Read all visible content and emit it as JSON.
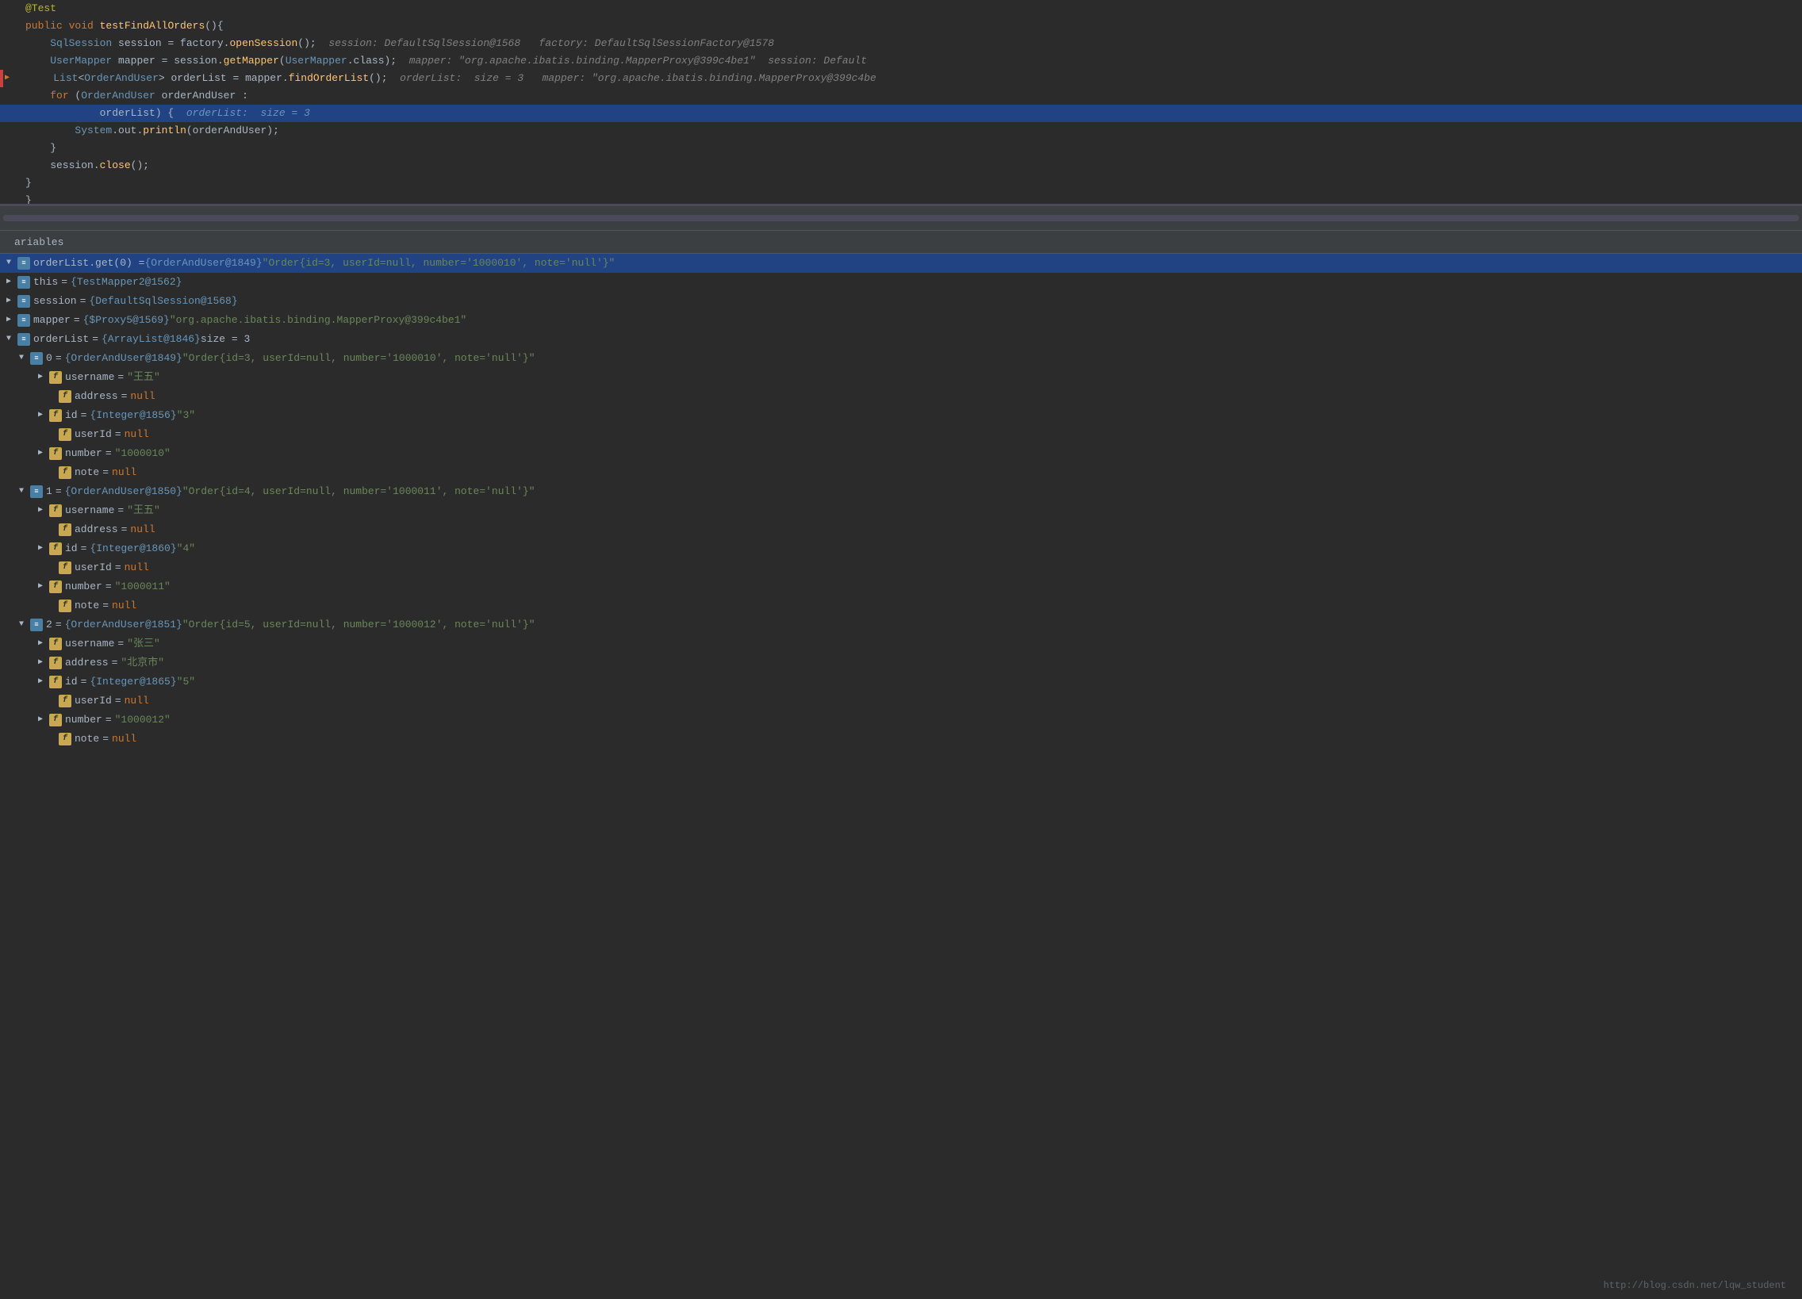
{
  "editor": {
    "lines": [
      {
        "id": 1,
        "gutter": "",
        "content": "@Test",
        "type": "annotation"
      },
      {
        "id": 2,
        "gutter": "",
        "content": "public void testFindAllOrders(){",
        "type": "normal"
      },
      {
        "id": 3,
        "gutter": "",
        "content": "    SqlSession session = factory.openSession();",
        "type": "normal",
        "debug": " session: DefaultSqlSession@1568   factory: DefaultSqlSessionFactory@1578"
      },
      {
        "id": 4,
        "gutter": "",
        "content": "    UserMapper mapper = session.getMapper(UserMapper.class);",
        "type": "normal",
        "debug": " mapper: \"org.apache.ibatis.binding.MapperProxy@399c4be1\"  session: Default"
      },
      {
        "id": 5,
        "gutter": "arrow",
        "content": "    List<OrderAndUser> orderList = mapper.findOrderList();",
        "type": "error",
        "debug": " orderList:  size = 3   mapper: \"org.apache.ibatis.binding.MapperProxy@399c4be"
      },
      {
        "id": 6,
        "gutter": "",
        "content": "    for (OrderAndUser orderAndUser :",
        "type": "normal"
      },
      {
        "id": 7,
        "gutter": "",
        "content": "            orderList) {",
        "type": "highlighted",
        "debug": " orderList:  size = 3"
      },
      {
        "id": 8,
        "gutter": "",
        "content": "        System.out.println(orderAndUser);",
        "type": "normal"
      },
      {
        "id": 9,
        "gutter": "",
        "content": "    }",
        "type": "normal"
      },
      {
        "id": 10,
        "gutter": "",
        "content": "    session.close();",
        "type": "normal"
      },
      {
        "id": 11,
        "gutter": "",
        "content": "}",
        "type": "normal"
      },
      {
        "id": 12,
        "gutter": "",
        "content": "}",
        "type": "normal"
      }
    ]
  },
  "variables_panel": {
    "title": "ariables",
    "selected_item": "orderList.get(0) = {OrderAndUser@1849} \"Order{id=3, userId=null, number='1000010', note='null'}\"",
    "items": [
      {
        "id": "orderlist-get0",
        "indent": 0,
        "arrow": "expanded",
        "icon": "stack",
        "name": "orderList.get(0) = {OrderAndUser@1849}",
        "value": "\"Order{id=3, userId=null, number='1000010', note='null'}\"",
        "selected": true
      },
      {
        "id": "this",
        "indent": 0,
        "arrow": "collapsed",
        "icon": "stack",
        "name": "this",
        "value": "= {TestMapper2@1562}"
      },
      {
        "id": "session",
        "indent": 0,
        "arrow": "collapsed",
        "icon": "stack",
        "name": "session",
        "value": "= {DefaultSqlSession@1568}"
      },
      {
        "id": "mapper",
        "indent": 0,
        "arrow": "collapsed",
        "icon": "stack",
        "name": "mapper",
        "value": "= {$Proxy5@1569} \"org.apache.ibatis.binding.MapperProxy@399c4be1\""
      },
      {
        "id": "orderlist",
        "indent": 0,
        "arrow": "expanded",
        "icon": "stack",
        "name": "orderList",
        "value": "= {ArrayList@1846}  size = 3"
      },
      {
        "id": "order0",
        "indent": 1,
        "arrow": "expanded",
        "icon": "stack",
        "name": "0",
        "value": "= {OrderAndUser@1849}  \"Order{id=3, userId=null, number='1000010', note='null'}\""
      },
      {
        "id": "order0-username",
        "indent": 2,
        "arrow": "collapsed",
        "icon": "f",
        "name": "username",
        "value": "= \"王五\""
      },
      {
        "id": "order0-address",
        "indent": 2,
        "arrow": "none",
        "icon": "f",
        "name": "address",
        "value": "= null",
        "null": true
      },
      {
        "id": "order0-id",
        "indent": 2,
        "arrow": "collapsed",
        "icon": "f",
        "name": "id",
        "value": "= {Integer@1856} \"3\""
      },
      {
        "id": "order0-userid",
        "indent": 2,
        "arrow": "none",
        "icon": "f",
        "name": "userId",
        "value": "= null",
        "null": true
      },
      {
        "id": "order0-number",
        "indent": 2,
        "arrow": "collapsed",
        "icon": "f",
        "name": "number",
        "value": "= \"1000010\""
      },
      {
        "id": "order0-note",
        "indent": 2,
        "arrow": "none",
        "icon": "f",
        "name": "note",
        "value": "= null",
        "null": true
      },
      {
        "id": "order1",
        "indent": 1,
        "arrow": "expanded",
        "icon": "stack",
        "name": "1",
        "value": "= {OrderAndUser@1850}  \"Order{id=4, userId=null, number='1000011', note='null'}\""
      },
      {
        "id": "order1-username",
        "indent": 2,
        "arrow": "collapsed",
        "icon": "f",
        "name": "username",
        "value": "= \"王五\""
      },
      {
        "id": "order1-address",
        "indent": 2,
        "arrow": "none",
        "icon": "f",
        "name": "address",
        "value": "= null",
        "null": true
      },
      {
        "id": "order1-id",
        "indent": 2,
        "arrow": "collapsed",
        "icon": "f",
        "name": "id",
        "value": "= {Integer@1860} \"4\""
      },
      {
        "id": "order1-userid",
        "indent": 2,
        "arrow": "none",
        "icon": "f",
        "name": "userId",
        "value": "= null",
        "null": true
      },
      {
        "id": "order1-number",
        "indent": 2,
        "arrow": "collapsed",
        "icon": "f",
        "name": "number",
        "value": "= \"1000011\""
      },
      {
        "id": "order1-note",
        "indent": 2,
        "arrow": "none",
        "icon": "f",
        "name": "note",
        "value": "= null",
        "null": true
      },
      {
        "id": "order2",
        "indent": 1,
        "arrow": "expanded",
        "icon": "stack",
        "name": "2",
        "value": "= {OrderAndUser@1851}  \"Order{id=5, userId=null, number='1000012', note='null'}\""
      },
      {
        "id": "order2-username",
        "indent": 2,
        "arrow": "collapsed",
        "icon": "f",
        "name": "username",
        "value": "= \"张三\""
      },
      {
        "id": "order2-address",
        "indent": 2,
        "arrow": "collapsed",
        "icon": "f",
        "name": "address",
        "value": "= \"北京市\""
      },
      {
        "id": "order2-id",
        "indent": 2,
        "arrow": "collapsed",
        "icon": "f",
        "name": "id",
        "value": "= {Integer@1865} \"5\""
      },
      {
        "id": "order2-userid",
        "indent": 2,
        "arrow": "none",
        "icon": "f",
        "name": "userId",
        "value": "= null",
        "null": true
      },
      {
        "id": "order2-number",
        "indent": 2,
        "arrow": "collapsed",
        "icon": "f",
        "name": "number",
        "value": "= \"1000012\""
      },
      {
        "id": "order2-note",
        "indent": 2,
        "arrow": "none",
        "icon": "f",
        "name": "note",
        "value": "= null",
        "null": true
      }
    ]
  },
  "footer": {
    "url": "http://blog.csdn.net/lqw_student"
  }
}
